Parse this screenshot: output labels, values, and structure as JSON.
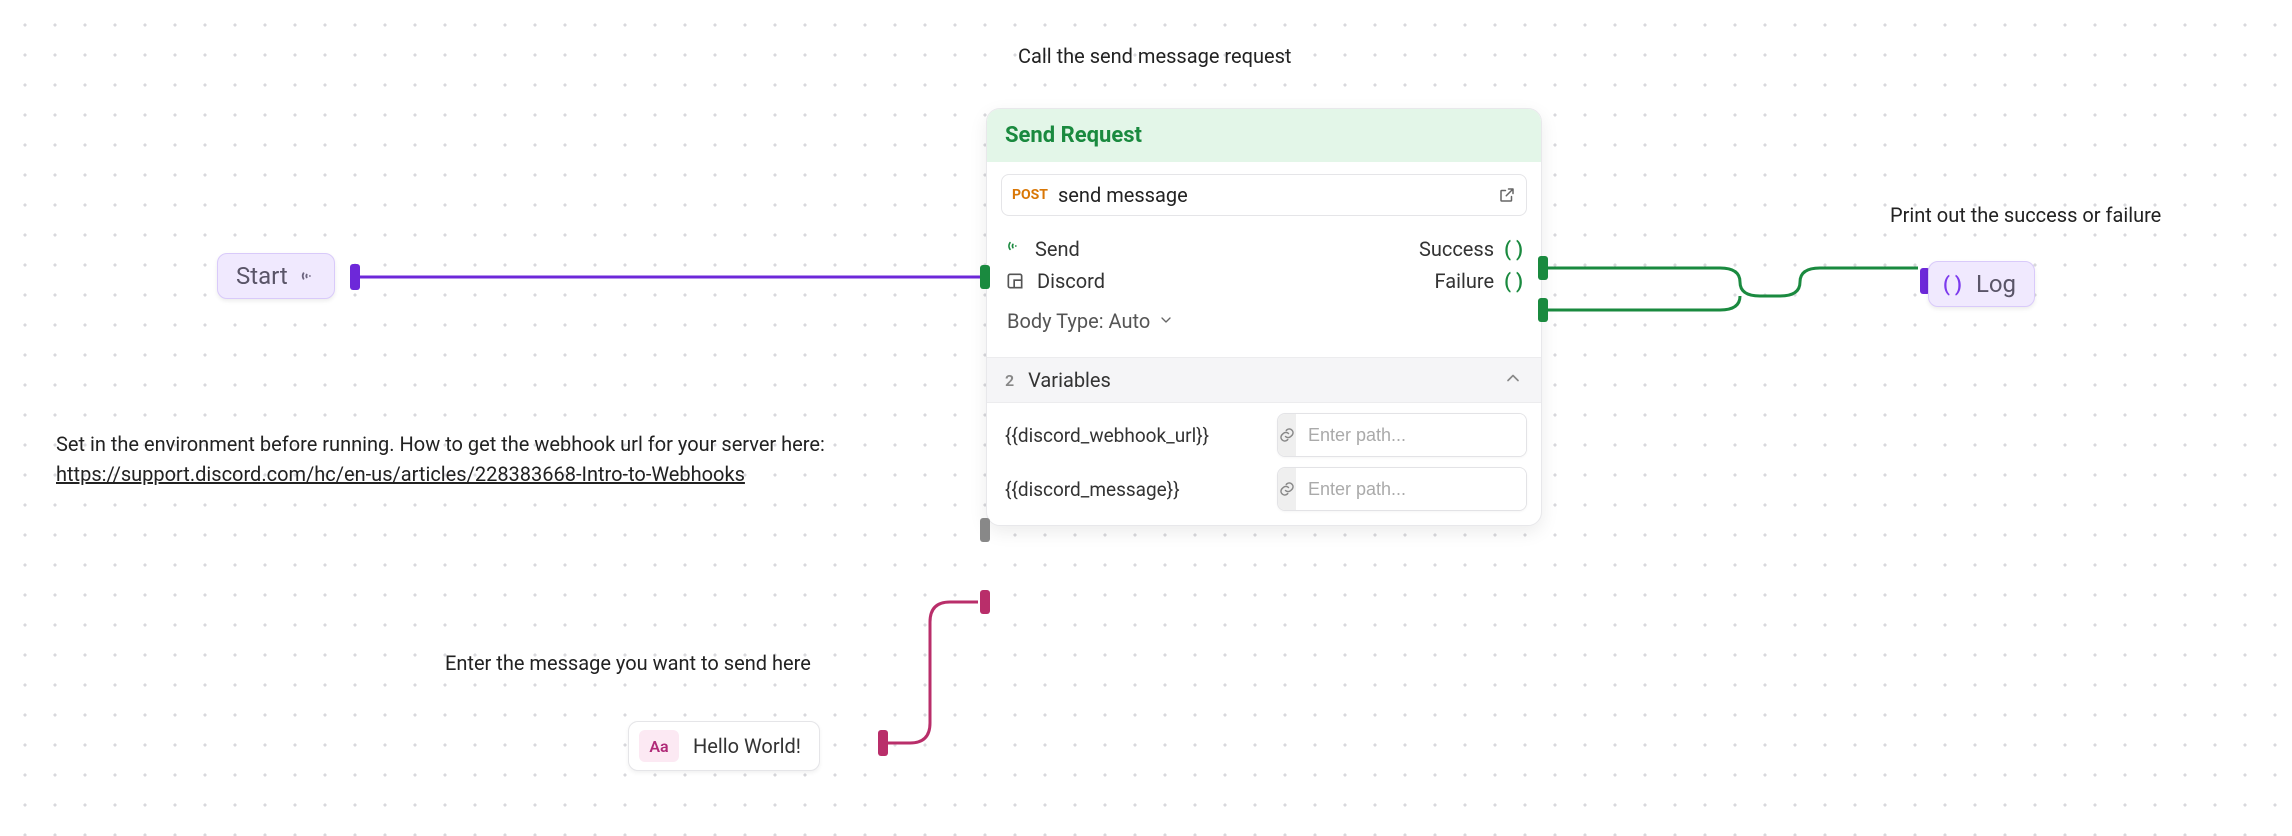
{
  "annotations": {
    "top": "Call the send message request",
    "env_prefix": "Set in the environment before running. How to get the webhook url for your server here: ",
    "env_link": "https://support.discord.com/hc/en-us/articles/228383668-Intro-to-Webhooks",
    "enter_msg": "Enter the message you want to send here",
    "print_out": "Print out the success or failure"
  },
  "start_node": {
    "label": "Start"
  },
  "hello_node": {
    "prefix": "Aa",
    "label": "Hello World!"
  },
  "log_node": {
    "paren": "( )",
    "label": "Log"
  },
  "card": {
    "title": "Send Request",
    "method": "POST",
    "request_name": "send message",
    "send_label": "Send",
    "success_label": "Success",
    "failure_label": "Failure",
    "success_paren": "( )",
    "failure_paren": "( )",
    "discord_label": "Discord",
    "body_type_label": "Body Type: Auto",
    "variables_count": "2",
    "variables_label": "Variables",
    "vars": [
      {
        "name": "{{discord_webhook_url}}",
        "placeholder": "Enter path..."
      },
      {
        "name": "{{discord_message}}",
        "placeholder": "Enter path..."
      }
    ]
  }
}
